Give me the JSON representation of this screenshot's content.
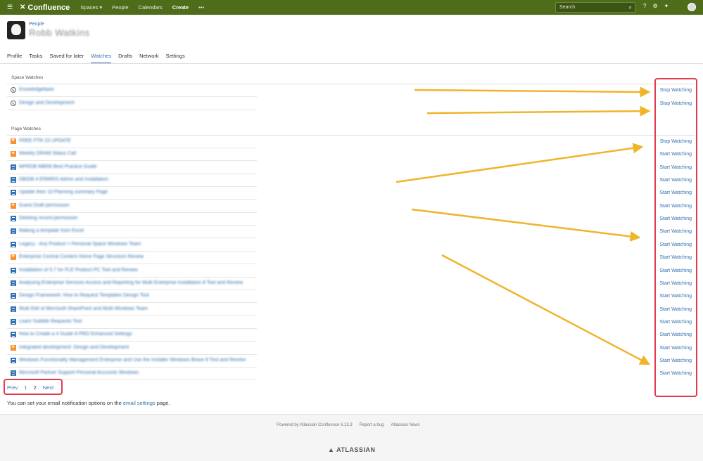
{
  "topnav": {
    "app_name": "Confluence",
    "spaces": "Spaces ▾",
    "people": "People",
    "calendars": "Calendars",
    "create": "Create",
    "more": "•••",
    "search_placeholder": "Search"
  },
  "profile": {
    "breadcrumb": "People",
    "name": "Robb Watkins"
  },
  "tabs": [
    "Profile",
    "Tasks",
    "Saved for later",
    "Watches",
    "Drafts",
    "Network",
    "Settings"
  ],
  "space_watches": {
    "title": "Space Watches",
    "items": [
      {
        "label": "Knowledgebase",
        "action": "Stop Watching"
      },
      {
        "label": "Design and Development",
        "action": "Stop Watching"
      }
    ]
  },
  "page_watches": {
    "title": "Page Watches",
    "items": [
      {
        "type": "blog",
        "label": "FREE FTR 23 UPDATE",
        "action": "Stop Watching"
      },
      {
        "type": "blog",
        "label": "Weekly DRAM Status Call",
        "action": "Start Watching"
      },
      {
        "type": "page",
        "label": "MPRDB MBR8 Best Practice Guide",
        "action": "Start Watching"
      },
      {
        "type": "page",
        "label": "DBIDB 4 ERMRIS Admin and Installation",
        "action": "Start Watching"
      },
      {
        "type": "page",
        "label": "Update their 10 Planning summary Page",
        "action": "Start Watching"
      },
      {
        "type": "blog",
        "label": "Guest Draft permission",
        "action": "Start Watching"
      },
      {
        "type": "page",
        "label": "Deleting record permission",
        "action": "Start Watching"
      },
      {
        "type": "page",
        "label": "Making a template from Excel",
        "action": "Start Watching"
      },
      {
        "type": "page",
        "label": "Legacy - Any Product > Personal Space Windows Team",
        "action": "Start Watching"
      },
      {
        "type": "blog",
        "label": "Enterprise Central Content Home Page Structure Review",
        "action": "Start Watching"
      },
      {
        "type": "page",
        "label": "Installation of 5.7 for FLE Product PC Tool and Review",
        "action": "Start Watching"
      },
      {
        "type": "page",
        "label": "Analysing Enterprise Services Access and Reporting for Multi Enterprise Installation 8 Tool and Review",
        "action": "Start Watching"
      },
      {
        "type": "page",
        "label": "Design Framework: How to Request Templates Design Tool",
        "action": "Start Watching"
      },
      {
        "type": "page",
        "label": "Multi Edit of Microsoft SharePoint and Multi Windows Team",
        "action": "Start Watching"
      },
      {
        "type": "page",
        "label": "Learn Subtitle Requests Tool",
        "action": "Start Watching"
      },
      {
        "type": "page",
        "label": "How to Create a 4 Guide 8 PRO Enhanced Settings",
        "action": "Start Watching"
      },
      {
        "type": "blog",
        "label": "Integrated development: Design and Development",
        "action": "Start Watching"
      },
      {
        "type": "page",
        "label": "Windows Functionality Management Enterprise and Use the Installer Windows Brave 8 Tool and Review",
        "action": "Start Watching"
      },
      {
        "type": "page",
        "label": "Microsoft Partner Support Personal Accounts Windows",
        "action": "Start Watching"
      }
    ]
  },
  "pager": {
    "prev": "Prev",
    "p1": "1",
    "p2": "2",
    "next": "Next"
  },
  "note": {
    "before": "You can set your email notification options on the ",
    "link": "email settings",
    "after": " page."
  },
  "footer": {
    "powered": "Powered by Atlassian Confluence 6.13.3",
    "report": "Report a bug",
    "news": "Atlassian News",
    "brand": "▲ ATLASSIAN"
  },
  "colors": {
    "nav": "#4e6c1a",
    "link": "#3572b0",
    "annotation_red": "#e03c4f",
    "annotation_arrow": "#f0b429"
  }
}
